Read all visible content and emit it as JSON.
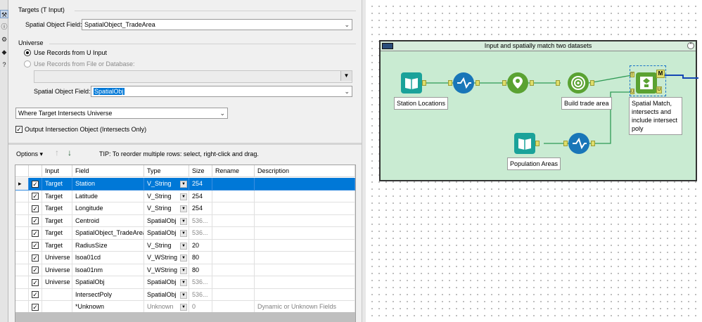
{
  "config": {
    "targets": {
      "group_title": "Targets (T Input)",
      "field_label": "Spatial Object Field:",
      "field_value": "SpatialObject_TradeArea"
    },
    "universe": {
      "group_title": "Universe",
      "radio_u": "Use Records from U Input",
      "radio_file": "Use Records from File or Database:",
      "field_label": "Spatial Object Field:",
      "field_value": "SpatialObj"
    },
    "action": {
      "value": "Where Target Intersects Universe"
    },
    "output_intersection": "Output Intersection Object (Intersects Only)",
    "options": {
      "label": "Options",
      "tip": "TIP: To reorder multiple rows: select, right-click and drag."
    },
    "grid": {
      "headers": [
        "Input",
        "Field",
        "Type",
        "Size",
        "Rename",
        "Description"
      ],
      "rows": [
        {
          "input": "Target",
          "field": "Station",
          "type": "V_String",
          "size": "254",
          "rename": "",
          "description": "",
          "checked": true,
          "selected": true
        },
        {
          "input": "Target",
          "field": "Latitude",
          "type": "V_String",
          "size": "254",
          "rename": "",
          "description": "",
          "checked": true,
          "selected": false
        },
        {
          "input": "Target",
          "field": "Longitude",
          "type": "V_String",
          "size": "254",
          "rename": "",
          "description": "",
          "checked": true,
          "selected": false
        },
        {
          "input": "Target",
          "field": "Centroid",
          "type": "SpatialObj",
          "size": "536...",
          "rename": "",
          "description": "",
          "checked": true,
          "selected": false
        },
        {
          "input": "Target",
          "field": "SpatialObject_TradeArea",
          "type": "SpatialObj",
          "size": "536...",
          "rename": "",
          "description": "",
          "checked": true,
          "selected": false
        },
        {
          "input": "Target",
          "field": "RadiusSize",
          "type": "V_String",
          "size": "20",
          "rename": "",
          "description": "",
          "checked": true,
          "selected": false
        },
        {
          "input": "Universe",
          "field": "lsoa01cd",
          "type": "V_WString",
          "size": "80",
          "rename": "",
          "description": "",
          "checked": true,
          "selected": false
        },
        {
          "input": "Universe",
          "field": "lsoa01nm",
          "type": "V_WString",
          "size": "80",
          "rename": "",
          "description": "",
          "checked": true,
          "selected": false
        },
        {
          "input": "Universe",
          "field": "SpatialObj",
          "type": "SpatialObj",
          "size": "536...",
          "rename": "",
          "description": "",
          "checked": true,
          "selected": false
        },
        {
          "input": "",
          "field": "IntersectPoly",
          "type": "SpatialObj",
          "size": "536...",
          "rename": "",
          "description": "",
          "checked": true,
          "selected": false
        },
        {
          "input": "",
          "field": "*Unknown",
          "type": "Unknown",
          "size": "0",
          "rename": "",
          "description": "Dynamic or Unknown Fields",
          "checked": true,
          "selected": false,
          "dim": true
        }
      ]
    }
  },
  "canvas": {
    "container_title": "Input and spatially match two datasets",
    "tools": {
      "station_locations": "Station Locations",
      "build_trade_area": "Build trade area",
      "spatial_match": "Spatial Match, intersects and include intersect poly",
      "population_areas": "Population Areas"
    },
    "anchor_labels": {
      "t": "T",
      "u": "U",
      "m": "M",
      "uu": "U"
    }
  }
}
